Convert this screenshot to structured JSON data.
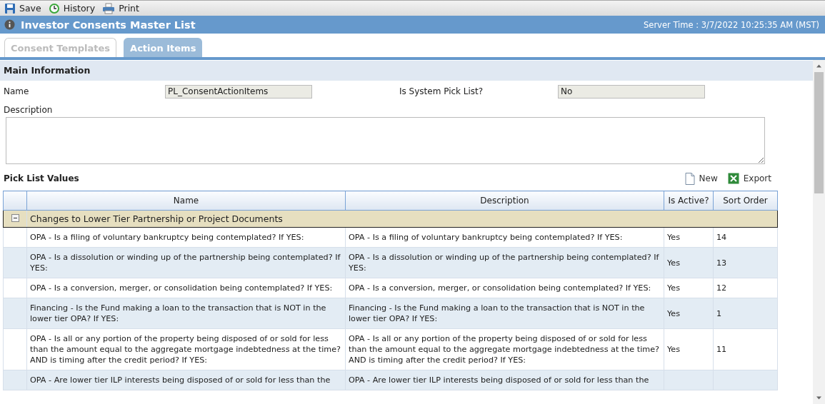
{
  "toolbar": [
    {
      "kind": "save",
      "label": "Save"
    },
    {
      "kind": "history",
      "label": "History"
    },
    {
      "kind": "print",
      "label": "Print"
    }
  ],
  "window": {
    "title": "Investor Consents Master List",
    "server_time": "Server Time : 3/7/2022 10:25:35 AM (MST)"
  },
  "tabs": [
    {
      "label": "Consent Templates",
      "selected": false
    },
    {
      "label": "Action Items",
      "selected": true
    }
  ],
  "main_information": {
    "heading": "Main Information",
    "name_label": "Name",
    "name_value": "PL_ConsentActionItems",
    "system_label": "Is System Pick List?",
    "system_value": "No",
    "description_label": "Description"
  },
  "pick_list": {
    "heading": "Pick List Values",
    "actions": [
      {
        "kind": "new",
        "label": "New"
      },
      {
        "kind": "export",
        "label": "Export"
      }
    ],
    "columns": [
      "Name",
      "Description",
      "Is Active?",
      "Sort Order"
    ],
    "group": {
      "label": "Changes to Lower Tier Partnership or Project Documents",
      "expanded": true
    },
    "rows": [
      {
        "name": "OPA - Is a filing of voluntary bankruptcy being contemplated? If YES:",
        "description": "OPA - Is a filing of voluntary bankruptcy being contemplated? If YES:",
        "active": "Yes",
        "sort_order": "14"
      },
      {
        "name": "OPA - Is a dissolution or winding up of the partnership being contemplated? If YES:",
        "description": "OPA - Is a dissolution or winding up of the partnership being contemplated? If YES:",
        "active": "Yes",
        "sort_order": "13"
      },
      {
        "name": "OPA - Is a conversion, merger, or consolidation being contemplated? If YES:",
        "description": "OPA - Is a conversion, merger, or consolidation being contemplated? If YES:",
        "active": "Yes",
        "sort_order": "12"
      },
      {
        "name": "Financing - Is the Fund making a loan to the transaction that is NOT in the lower tier OPA? If YES:",
        "description": "Financing - Is the Fund making a loan to the transaction that is NOT in the lower tier OPA? If YES:",
        "active": "Yes",
        "sort_order": "1"
      },
      {
        "name": "OPA - Is all or any portion of the property being disposed of or sold for less than the amount equal to the aggregate mortgage indebtedness at the time? AND is timing after the credit period? If YES:",
        "description": "OPA - Is all or any portion of the property being disposed of or sold for less than the amount equal to the aggregate mortgage indebtedness at the time? AND is timing after the credit period? If YES:",
        "active": "Yes",
        "sort_order": "11"
      },
      {
        "name": "OPA - Are lower tier ILP interests being disposed of or sold for less than the",
        "description": "OPA - Are lower tier ILP interests being disposed of or sold for less than the"
      }
    ]
  }
}
